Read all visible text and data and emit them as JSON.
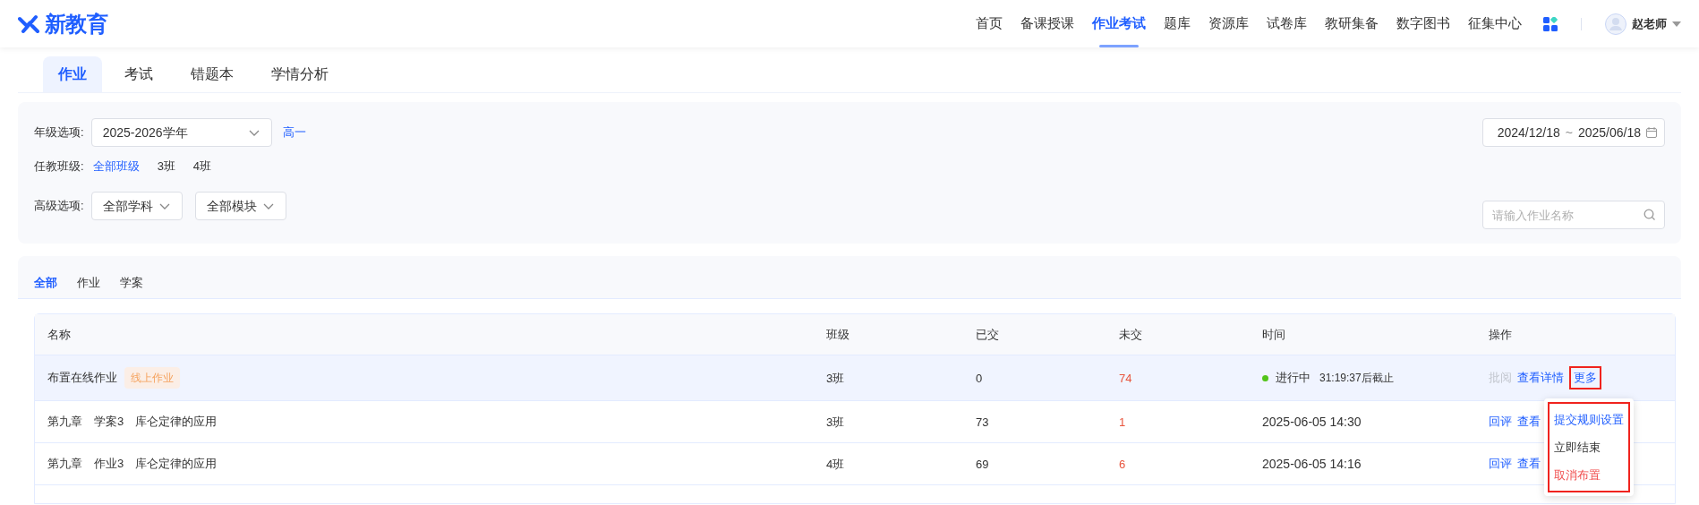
{
  "logo": {
    "text": "新教育"
  },
  "nav": [
    {
      "label": "首页",
      "selected": false
    },
    {
      "label": "备课授课",
      "selected": false
    },
    {
      "label": "作业考试",
      "selected": true
    },
    {
      "label": "题库",
      "selected": false
    },
    {
      "label": "资源库",
      "selected": false
    },
    {
      "label": "试卷库",
      "selected": false
    },
    {
      "label": "教研集备",
      "selected": false
    },
    {
      "label": "数字图书",
      "selected": false
    },
    {
      "label": "征集中心",
      "selected": false
    }
  ],
  "user": {
    "name": "赵老师"
  },
  "subtabs": [
    {
      "label": "作业",
      "selected": true
    },
    {
      "label": "考试",
      "selected": false
    },
    {
      "label": "错题本",
      "selected": false
    },
    {
      "label": "学情分析",
      "selected": false
    }
  ],
  "filters": {
    "grade": {
      "label": "年级选项:",
      "value": "2025-2026学年",
      "tag": "高一"
    },
    "classes": {
      "label": "任教班级:",
      "options": [
        {
          "label": "全部班级",
          "selected": true
        },
        {
          "label": "3班",
          "selected": false
        },
        {
          "label": "4班",
          "selected": false
        }
      ]
    },
    "advanced": {
      "label": "高级选项:",
      "dropdowns": [
        "全部学科",
        "全部模块"
      ]
    },
    "date_range": {
      "start": "2024/12/18",
      "separator": "~",
      "end": "2025/06/18"
    },
    "search": {
      "placeholder": "请输入作业名称"
    }
  },
  "type_tabs": [
    {
      "label": "全部",
      "selected": true
    },
    {
      "label": "作业",
      "selected": false
    },
    {
      "label": "学案",
      "selected": false
    }
  ],
  "table": {
    "columns": [
      "名称",
      "班级",
      "已交",
      "未交",
      "时间",
      "操作"
    ],
    "rows": [
      {
        "name": "布置在线作业",
        "tag": "线上作业",
        "class": "3班",
        "submitted": "0",
        "unsubmitted": "74",
        "kind": "ongoing",
        "status": "进行中",
        "time": "31:19:37后截止",
        "selected": true,
        "actions": [
          {
            "label": "批阅",
            "disabled": true,
            "highlighted": false
          },
          {
            "label": "查看详情",
            "disabled": false,
            "highlighted": false
          },
          {
            "label": "更多",
            "disabled": false,
            "highlighted": true
          }
        ]
      },
      {
        "name": "第九章　学案3　库仑定律的应用",
        "class": "3班",
        "submitted": "73",
        "unsubmitted": "1",
        "kind": "done",
        "time": "2025-06-05 14:30",
        "selected": false,
        "actions": [
          {
            "label": "回评",
            "disabled": false,
            "highlighted": false
          },
          {
            "label": "查看",
            "disabled": false,
            "highlighted": false
          }
        ]
      },
      {
        "name": "第九章　作业3　库仑定律的应用",
        "class": "4班",
        "submitted": "69",
        "unsubmitted": "6",
        "kind": "done",
        "time": "2025-06-05 14:16",
        "selected": false,
        "actions": [
          {
            "label": "回评",
            "disabled": false,
            "highlighted": false
          },
          {
            "label": "查看",
            "disabled": false,
            "highlighted": false
          }
        ]
      }
    ]
  },
  "menu": {
    "highlighted": true,
    "items": [
      {
        "label": "提交规则设置",
        "kind": "primary"
      },
      {
        "label": "立即结束",
        "kind": "normal"
      },
      {
        "label": "取消布置",
        "kind": "danger"
      }
    ]
  }
}
